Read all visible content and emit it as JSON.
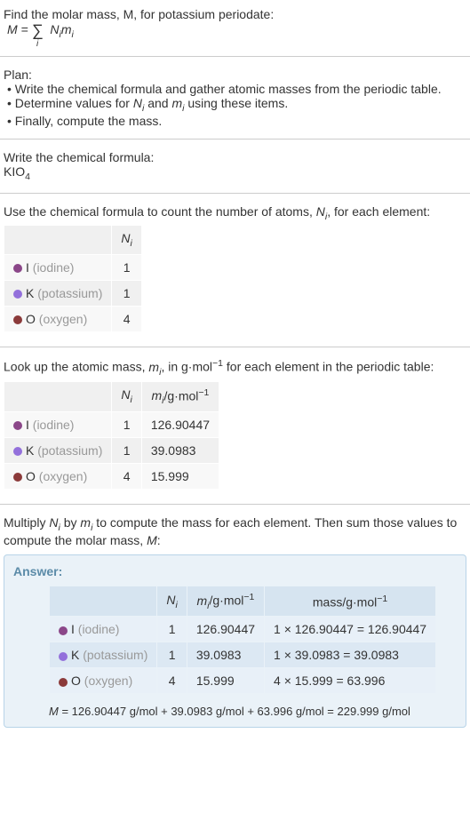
{
  "intro": {
    "line1": "Find the molar mass, M, for potassium periodate:",
    "formula_M": "M",
    "equals": " = ",
    "sigma": "∑",
    "sigma_sub": "i",
    "Ni_mi_part": "N",
    "i_sub_1": "i",
    "m": "m",
    "i_sub_2": "i"
  },
  "plan": {
    "title": "Plan:",
    "bullet1_a": "• Write the chemical formula and gather atomic masses from the periodic table.",
    "bullet2_a": "• Determine values for ",
    "bullet2_N": "N",
    "bullet2_i1": "i",
    "bullet2_and": " and ",
    "bullet2_m": "m",
    "bullet2_i2": "i",
    "bullet2_end": " using these items.",
    "bullet3": "• Finally, compute the mass."
  },
  "chem_formula": {
    "title": "Write the chemical formula:",
    "formula_k": "KIO",
    "formula_4": "4"
  },
  "count_section": {
    "text_a": "Use the chemical formula to count the number of atoms, ",
    "N": "N",
    "i": "i",
    "text_b": ", for each element:"
  },
  "table1": {
    "header_N": "N",
    "header_i": "i",
    "rows": [
      {
        "sym": "I",
        "name": "(iodine)",
        "dot": "dot-i",
        "N": "1"
      },
      {
        "sym": "K",
        "name": "(potassium)",
        "dot": "dot-k",
        "N": "1"
      },
      {
        "sym": "O",
        "name": "(oxygen)",
        "dot": "dot-o",
        "N": "4"
      }
    ]
  },
  "lookup_section": {
    "text_a": "Look up the atomic mass, ",
    "m": "m",
    "i": "i",
    "text_b": ", in g·mol",
    "neg1": "−1",
    "text_c": " for each element in the periodic table:"
  },
  "table2": {
    "header_N": "N",
    "header_N_i": "i",
    "header_m": "m",
    "header_m_i": "i",
    "header_unit_a": "/g·mol",
    "header_unit_neg1": "−1",
    "rows": [
      {
        "sym": "I",
        "name": "(iodine)",
        "dot": "dot-i",
        "N": "1",
        "m": "126.90447"
      },
      {
        "sym": "K",
        "name": "(potassium)",
        "dot": "dot-k",
        "N": "1",
        "m": "39.0983"
      },
      {
        "sym": "O",
        "name": "(oxygen)",
        "dot": "dot-o",
        "N": "4",
        "m": "15.999"
      }
    ]
  },
  "multiply_section": {
    "text_a": "Multiply ",
    "N": "N",
    "N_i": "i",
    "text_by": " by ",
    "m": "m",
    "m_i": "i",
    "text_b": " to compute the mass for each element. Then sum those values to compute the molar mass, ",
    "M": "M",
    "colon": ":"
  },
  "answer": {
    "label": "Answer:",
    "header_N": "N",
    "header_N_i": "i",
    "header_m": "m",
    "header_m_i": "i",
    "header_m_unit": "/g·mol",
    "header_m_neg1": "−1",
    "header_mass": "mass/g·mol",
    "header_mass_neg1": "−1",
    "rows": [
      {
        "sym": "I",
        "name": "(iodine)",
        "dot": "dot-i",
        "N": "1",
        "m": "126.90447",
        "mass": "1 × 126.90447 = 126.90447"
      },
      {
        "sym": "K",
        "name": "(potassium)",
        "dot": "dot-k",
        "N": "1",
        "m": "39.0983",
        "mass": "1 × 39.0983 = 39.0983"
      },
      {
        "sym": "O",
        "name": "(oxygen)",
        "dot": "dot-o",
        "N": "4",
        "m": "15.999",
        "mass": "4 × 15.999 = 63.996"
      }
    ],
    "final_M": "M",
    "final_eq": " = 126.90447 g/mol + 39.0983 g/mol + 63.996 g/mol = 229.999 g/mol"
  }
}
